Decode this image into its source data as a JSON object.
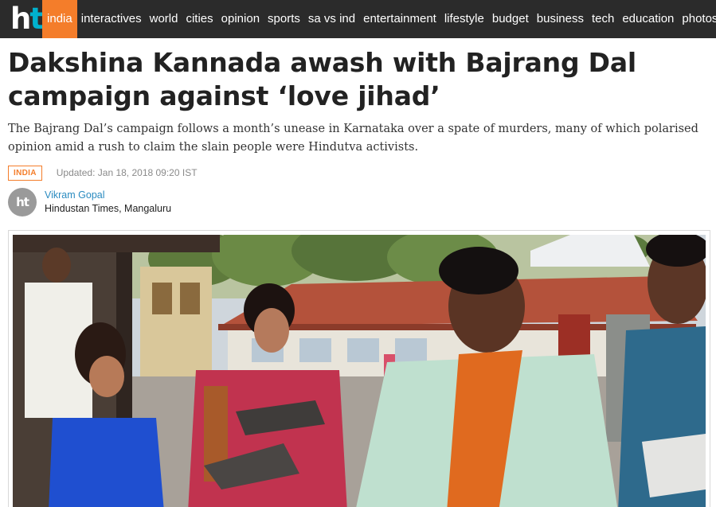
{
  "nav": {
    "logo": {
      "part1": "h",
      "part2": "t"
    },
    "active": "india",
    "items": [
      "interactives",
      "world",
      "cities",
      "opinion",
      "sports",
      "sa vs ind",
      "entertainment",
      "lifestyle",
      "budget",
      "business",
      "tech",
      "education",
      "photos"
    ]
  },
  "article": {
    "headline_line1": "Dakshina Kannada awash with Bajrang Dal",
    "headline_line2": "campaign against ‘love jihad’",
    "summary": "The Bajrang Dal’s campaign follows a month’s unease in Karnataka over a spate of murders, many of which polarised opinion amid a rush to claim the slain people were Hindutva activists.",
    "section": "INDIA",
    "updated": "Updated: Jan 18, 2018 09:20 IST",
    "author": "Vikram Gopal",
    "affiliation": "Hindustan Times, Mangaluru",
    "avatar_text": "ht"
  },
  "colors": {
    "nav_bg": "#2b2b2b",
    "accent": "#f47d2a",
    "logo_t": "#00b1cd",
    "author_link": "#2a8bc0"
  }
}
